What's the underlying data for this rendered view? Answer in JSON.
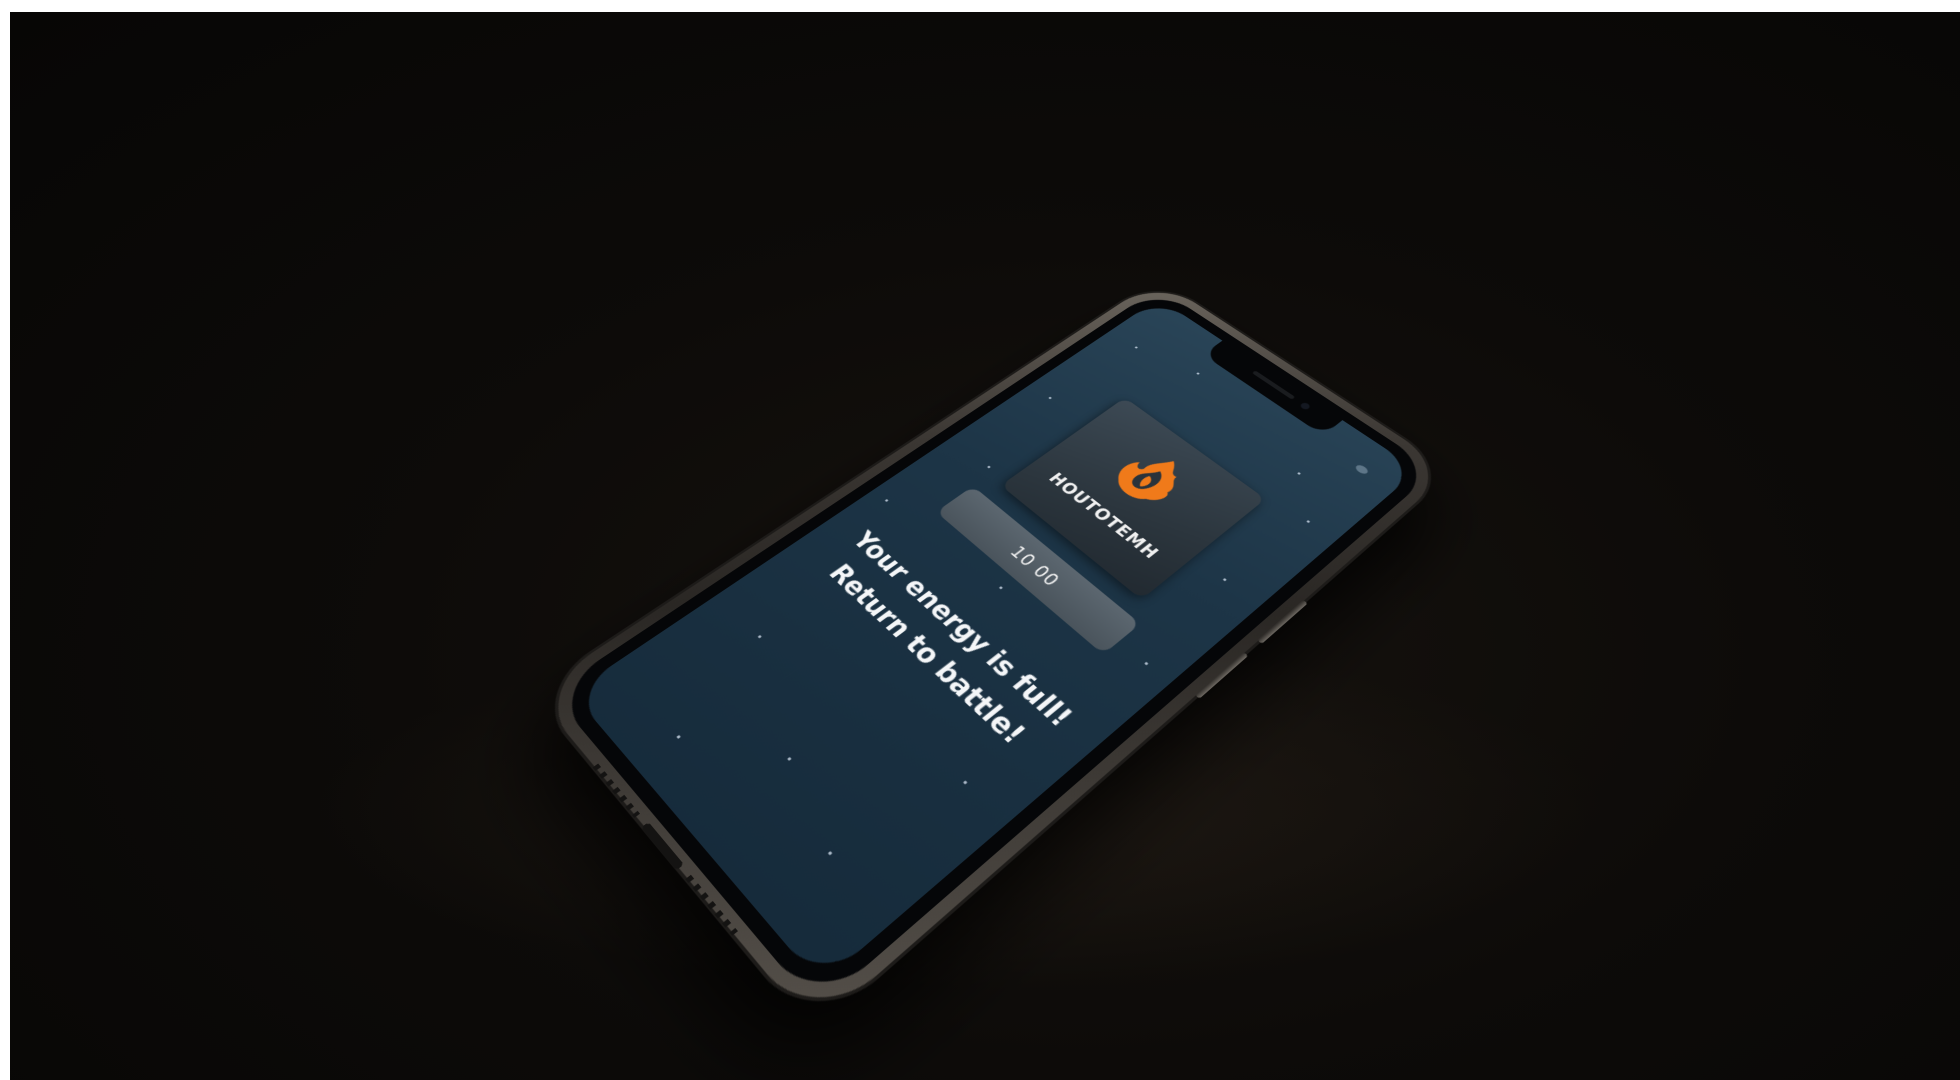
{
  "scene": {
    "background_color": "#0b0908",
    "phone_frame_color": "#3b3733",
    "screen_color": "#1d3547"
  },
  "app_screen": {
    "logo": {
      "icon": "orange-flame-emblem-icon",
      "icon_color": "#f07a1a",
      "wordmark": "HOUTOTEMH"
    },
    "button_label": "10 00",
    "message_line_1": "Your energy is full!",
    "message_line_2": "Return to battle!"
  }
}
